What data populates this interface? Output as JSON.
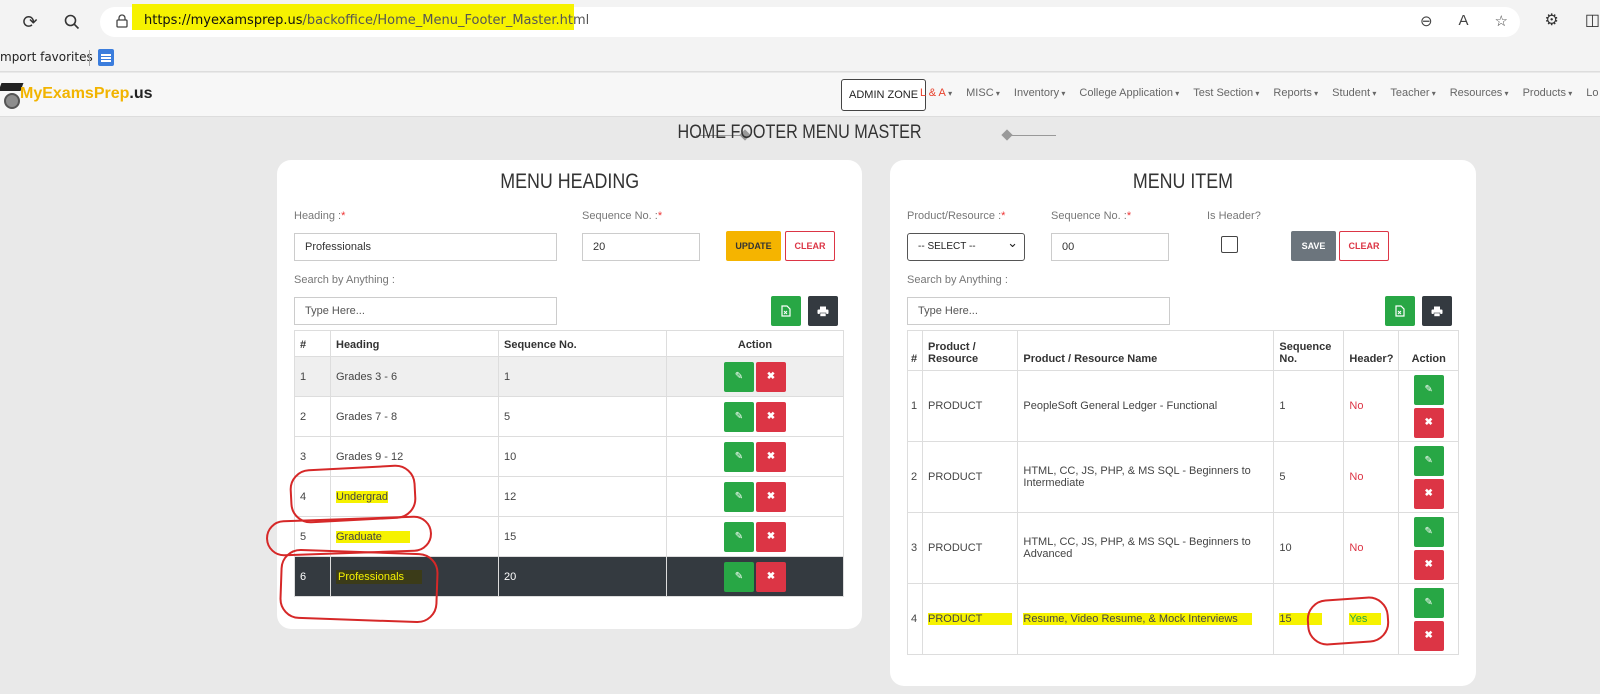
{
  "browser": {
    "url_host": "https://myexamsprep.us",
    "url_path": "/backoffice/Home_Menu_Footer_Master.html",
    "favorites_label": "mport favorites"
  },
  "site": {
    "logo_main": "MyExamsPrep",
    "logo_tld": ".us",
    "admin_zone": "ADMIN ZONE",
    "menu": [
      "L & A",
      "MISC",
      "Inventory",
      "College Application",
      "Test Section",
      "Reports",
      "Student",
      "Teacher",
      "Resources",
      "Products",
      "Lo"
    ]
  },
  "page_title": "HOME FOOTER MENU MASTER",
  "heading_card": {
    "title": "MENU HEADING",
    "heading_label": "Heading :",
    "heading_value": "Professionals",
    "sequence_label": "Sequence No. :",
    "sequence_value": "20",
    "update_label": "UPDATE",
    "clear_label": "CLEAR",
    "search_label": "Search by Anything :",
    "search_placeholder": "Type Here...",
    "columns": [
      "#",
      "Heading",
      "Sequence No.",
      "Action"
    ],
    "rows": [
      {
        "num": "1",
        "heading": "Grades 3 - 6",
        "seq": "1"
      },
      {
        "num": "2",
        "heading": "Grades 7 - 8",
        "seq": "5"
      },
      {
        "num": "3",
        "heading": "Grades 9 - 12",
        "seq": "10"
      },
      {
        "num": "4",
        "heading": "Undergrad",
        "seq": "12"
      },
      {
        "num": "5",
        "heading": "Graduate",
        "seq": "15"
      },
      {
        "num": "6",
        "heading": "Professionals",
        "seq": "20"
      }
    ]
  },
  "item_card": {
    "title": "MENU ITEM",
    "product_label": "Product/Resource :",
    "product_value": "-- SELECT --",
    "sequence_label": "Sequence No. :",
    "sequence_value": "00",
    "is_header_label": "Is Header?",
    "save_label": "SAVE",
    "clear_label": "CLEAR",
    "search_label": "Search by Anything :",
    "search_placeholder": "Type Here...",
    "columns": [
      "#",
      "Product / Resource",
      "Product / Resource Name",
      "Sequence No.",
      "Header?",
      "Action"
    ],
    "rows": [
      {
        "num": "1",
        "type": "PRODUCT",
        "name": "PeopleSoft General Ledger - Functional",
        "seq": "1",
        "header": "No"
      },
      {
        "num": "2",
        "type": "PRODUCT",
        "name": "HTML, CC, JS, PHP, & MS SQL - Beginners to Intermediate",
        "seq": "5",
        "header": "No"
      },
      {
        "num": "3",
        "type": "PRODUCT",
        "name": "HTML, CC, JS, PHP, & MS SQL - Beginners to Advanced",
        "seq": "10",
        "header": "No"
      },
      {
        "num": "4",
        "type": "PRODUCT",
        "name": "Resume, Video Resume, & Mock Interviews",
        "seq": "15",
        "header": "Yes"
      }
    ]
  },
  "colors": {
    "highlight": "#f6f200",
    "annotation": "#d62828",
    "edit": "#28a745",
    "delete": "#dc3545",
    "update": "#f5b400"
  }
}
